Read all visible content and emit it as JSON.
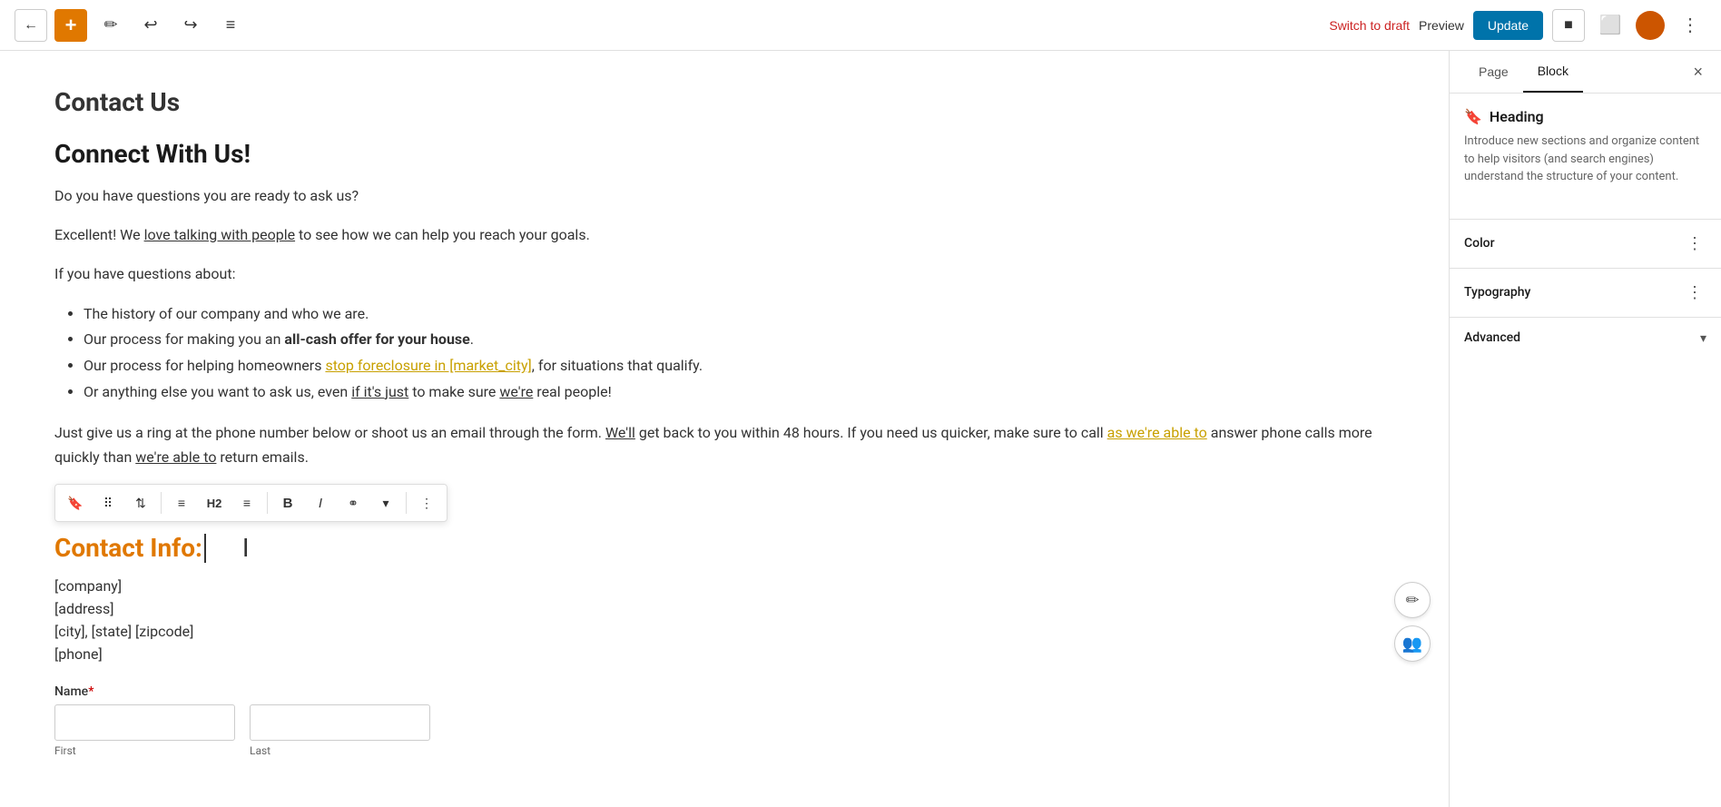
{
  "toolbar": {
    "back_icon": "←",
    "add_icon": "+",
    "tools_icon": "✏",
    "undo_icon": "↩",
    "redo_icon": "↪",
    "list_icon": "≡",
    "switch_draft_label": "Switch to draft",
    "preview_label": "Preview",
    "update_label": "Update",
    "settings_icon": "⚙",
    "more_icon": "⋮"
  },
  "page_title": "Contact Us",
  "content": {
    "main_heading": "Connect With Us!",
    "para1": "Do you have questions you are ready to ask us?",
    "para2_prefix": "Excellent! We ",
    "para2_highlight": "love talking with people",
    "para2_suffix": " to see how we can help you reach your goals.",
    "para3": "If you have questions about:",
    "list_items": [
      "The history of our company and who we are.",
      "Our process for making you an all-cash offer for your house.",
      "Our process for helping homeowners stop foreclosure in [market_city], for situations that qualify.",
      "Or anything else you want to ask us, even if it's just to make sure we're real people!"
    ],
    "para4_prefix": "Just give us a ring at the phone number below or shoot us an email through the form. We'll get back to you within 48 hours. If you need us quicker, make sure to call ",
    "para4_link": "as we're able to",
    "para4_suffix": " answer phone calls more quickly than we're able to return emails.",
    "contact_heading": "Contact Info:",
    "company": "[company]",
    "address": "[address]",
    "city_state": "[city], [state] [zipcode]",
    "phone": "[phone]",
    "name_label": "Name",
    "name_required": "*",
    "first_label": "First",
    "last_label": "Last"
  },
  "floating_toolbar": {
    "bookmark_icon": "🔖",
    "drag_icon": "⠿",
    "updown_icon": "⇅",
    "align_icon": "≡",
    "h2_label": "H2",
    "align2_icon": "≡",
    "bold_icon": "B",
    "italic_icon": "I",
    "link_icon": "⚭",
    "dropdown_icon": "▾",
    "more_icon": "⋮"
  },
  "right_panel": {
    "page_tab": "Page",
    "block_tab": "Block",
    "close_icon": "×",
    "block_info": {
      "icon": "🔖",
      "title": "Heading",
      "description": "Introduce new sections and organize content to help visitors (and search engines) understand the structure of your content."
    },
    "sections": [
      {
        "id": "color",
        "title": "Color",
        "has_dots": true,
        "has_chevron": false,
        "dots_icon": "⋮"
      },
      {
        "id": "typography",
        "title": "Typography",
        "has_dots": true,
        "has_chevron": false,
        "dots_icon": "⋮"
      },
      {
        "id": "advanced",
        "title": "Advanced",
        "has_dots": false,
        "has_chevron": true,
        "chevron_icon": "▾"
      }
    ]
  },
  "colors": {
    "orange": "#e07800",
    "link_gold": "#c8a000",
    "update_blue": "#0073aa",
    "switch_draft_red": "#cc2222"
  }
}
